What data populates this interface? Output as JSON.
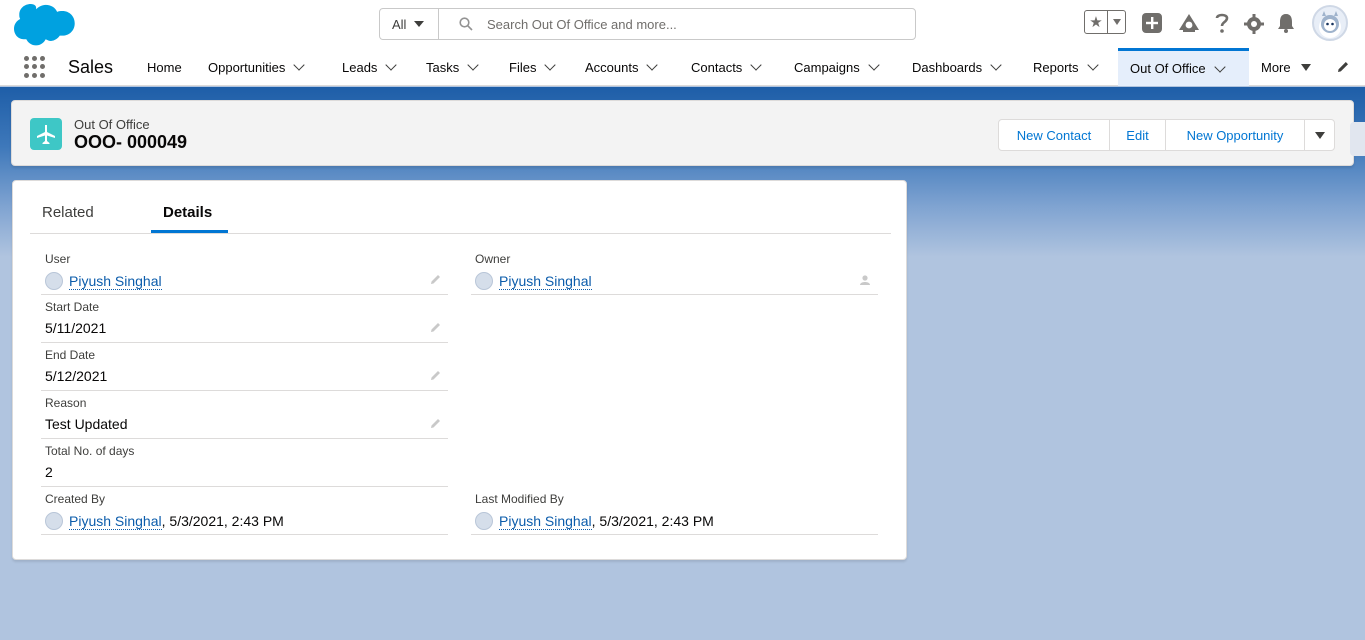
{
  "global": {
    "search_scope": "All",
    "search_placeholder": "Search Out Of Office and more..."
  },
  "nav": {
    "app_name": "Sales",
    "items": [
      {
        "label": "Home"
      },
      {
        "label": "Opportunities"
      },
      {
        "label": "Leads"
      },
      {
        "label": "Tasks"
      },
      {
        "label": "Files"
      },
      {
        "label": "Accounts"
      },
      {
        "label": "Contacts"
      },
      {
        "label": "Campaigns"
      },
      {
        "label": "Dashboards"
      },
      {
        "label": "Reports"
      },
      {
        "label": "Out Of Office"
      },
      {
        "label": "More"
      }
    ]
  },
  "record": {
    "type": "Out Of Office",
    "title": "OOO- 000049",
    "actions": [
      "New Contact",
      "Edit",
      "New Opportunity"
    ]
  },
  "tabs": {
    "related": "Related",
    "details": "Details"
  },
  "fields": {
    "user": {
      "label": "User",
      "value": "Piyush Singhal"
    },
    "owner": {
      "label": "Owner",
      "value": "Piyush Singhal"
    },
    "start_date": {
      "label": "Start Date",
      "value": "5/11/2021"
    },
    "end_date": {
      "label": "End Date",
      "value": "5/12/2021"
    },
    "reason": {
      "label": "Reason",
      "value": "Test Updated"
    },
    "total_days": {
      "label": "Total No. of days",
      "value": "2"
    },
    "created_by": {
      "label": "Created By",
      "name": "Piyush Singhal",
      "date": ", 5/3/2021, 2:43 PM"
    },
    "last_modified_by": {
      "label": "Last Modified By",
      "name": "Piyush Singhal",
      "date": ", 5/3/2021, 2:43 PM"
    }
  },
  "colors": {
    "brand": "#0176d3",
    "link": "#0b5cab",
    "record_icon": "#3ec7c6"
  }
}
